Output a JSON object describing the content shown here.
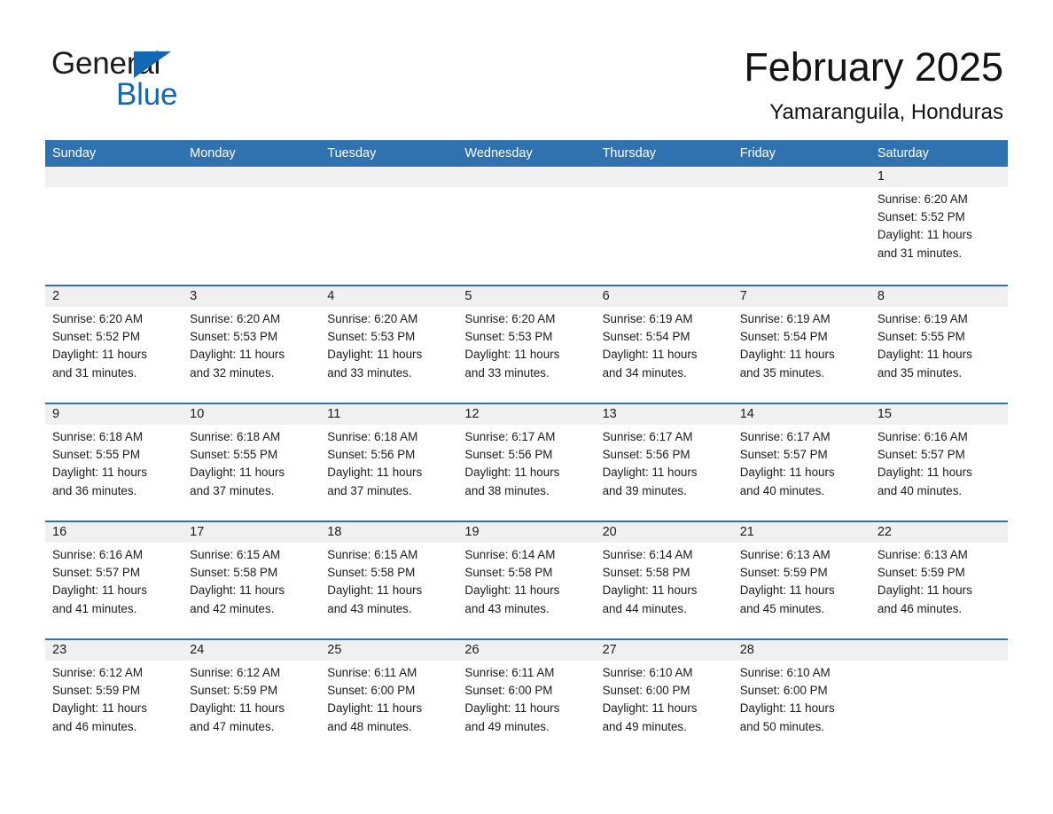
{
  "brand": {
    "name_part1": "General",
    "name_part2": "Blue",
    "triangle_color": "#1368b5",
    "text_color": "#1c1c1c"
  },
  "header": {
    "title": "February 2025",
    "subtitle": "Yamaranguila, Honduras"
  },
  "theme": {
    "header_blue": "#3071b0",
    "daynum_band": "#f0f0f0",
    "cell_background": "#ffffff",
    "text": "#1b1b1b"
  },
  "weekdays": [
    "Sunday",
    "Monday",
    "Tuesday",
    "Wednesday",
    "Thursday",
    "Friday",
    "Saturday"
  ],
  "weeks": [
    [
      {
        "day": "",
        "sunrise": "",
        "sunset": "",
        "daylight1": "",
        "daylight2": ""
      },
      {
        "day": "",
        "sunrise": "",
        "sunset": "",
        "daylight1": "",
        "daylight2": ""
      },
      {
        "day": "",
        "sunrise": "",
        "sunset": "",
        "daylight1": "",
        "daylight2": ""
      },
      {
        "day": "",
        "sunrise": "",
        "sunset": "",
        "daylight1": "",
        "daylight2": ""
      },
      {
        "day": "",
        "sunrise": "",
        "sunset": "",
        "daylight1": "",
        "daylight2": ""
      },
      {
        "day": "",
        "sunrise": "",
        "sunset": "",
        "daylight1": "",
        "daylight2": ""
      },
      {
        "day": "1",
        "sunrise": "Sunrise: 6:20 AM",
        "sunset": "Sunset: 5:52 PM",
        "daylight1": "Daylight: 11 hours",
        "daylight2": "and 31 minutes."
      }
    ],
    [
      {
        "day": "2",
        "sunrise": "Sunrise: 6:20 AM",
        "sunset": "Sunset: 5:52 PM",
        "daylight1": "Daylight: 11 hours",
        "daylight2": "and 31 minutes."
      },
      {
        "day": "3",
        "sunrise": "Sunrise: 6:20 AM",
        "sunset": "Sunset: 5:53 PM",
        "daylight1": "Daylight: 11 hours",
        "daylight2": "and 32 minutes."
      },
      {
        "day": "4",
        "sunrise": "Sunrise: 6:20 AM",
        "sunset": "Sunset: 5:53 PM",
        "daylight1": "Daylight: 11 hours",
        "daylight2": "and 33 minutes."
      },
      {
        "day": "5",
        "sunrise": "Sunrise: 6:20 AM",
        "sunset": "Sunset: 5:53 PM",
        "daylight1": "Daylight: 11 hours",
        "daylight2": "and 33 minutes."
      },
      {
        "day": "6",
        "sunrise": "Sunrise: 6:19 AM",
        "sunset": "Sunset: 5:54 PM",
        "daylight1": "Daylight: 11 hours",
        "daylight2": "and 34 minutes."
      },
      {
        "day": "7",
        "sunrise": "Sunrise: 6:19 AM",
        "sunset": "Sunset: 5:54 PM",
        "daylight1": "Daylight: 11 hours",
        "daylight2": "and 35 minutes."
      },
      {
        "day": "8",
        "sunrise": "Sunrise: 6:19 AM",
        "sunset": "Sunset: 5:55 PM",
        "daylight1": "Daylight: 11 hours",
        "daylight2": "and 35 minutes."
      }
    ],
    [
      {
        "day": "9",
        "sunrise": "Sunrise: 6:18 AM",
        "sunset": "Sunset: 5:55 PM",
        "daylight1": "Daylight: 11 hours",
        "daylight2": "and 36 minutes."
      },
      {
        "day": "10",
        "sunrise": "Sunrise: 6:18 AM",
        "sunset": "Sunset: 5:55 PM",
        "daylight1": "Daylight: 11 hours",
        "daylight2": "and 37 minutes."
      },
      {
        "day": "11",
        "sunrise": "Sunrise: 6:18 AM",
        "sunset": "Sunset: 5:56 PM",
        "daylight1": "Daylight: 11 hours",
        "daylight2": "and 37 minutes."
      },
      {
        "day": "12",
        "sunrise": "Sunrise: 6:17 AM",
        "sunset": "Sunset: 5:56 PM",
        "daylight1": "Daylight: 11 hours",
        "daylight2": "and 38 minutes."
      },
      {
        "day": "13",
        "sunrise": "Sunrise: 6:17 AM",
        "sunset": "Sunset: 5:56 PM",
        "daylight1": "Daylight: 11 hours",
        "daylight2": "and 39 minutes."
      },
      {
        "day": "14",
        "sunrise": "Sunrise: 6:17 AM",
        "sunset": "Sunset: 5:57 PM",
        "daylight1": "Daylight: 11 hours",
        "daylight2": "and 40 minutes."
      },
      {
        "day": "15",
        "sunrise": "Sunrise: 6:16 AM",
        "sunset": "Sunset: 5:57 PM",
        "daylight1": "Daylight: 11 hours",
        "daylight2": "and 40 minutes."
      }
    ],
    [
      {
        "day": "16",
        "sunrise": "Sunrise: 6:16 AM",
        "sunset": "Sunset: 5:57 PM",
        "daylight1": "Daylight: 11 hours",
        "daylight2": "and 41 minutes."
      },
      {
        "day": "17",
        "sunrise": "Sunrise: 6:15 AM",
        "sunset": "Sunset: 5:58 PM",
        "daylight1": "Daylight: 11 hours",
        "daylight2": "and 42 minutes."
      },
      {
        "day": "18",
        "sunrise": "Sunrise: 6:15 AM",
        "sunset": "Sunset: 5:58 PM",
        "daylight1": "Daylight: 11 hours",
        "daylight2": "and 43 minutes."
      },
      {
        "day": "19",
        "sunrise": "Sunrise: 6:14 AM",
        "sunset": "Sunset: 5:58 PM",
        "daylight1": "Daylight: 11 hours",
        "daylight2": "and 43 minutes."
      },
      {
        "day": "20",
        "sunrise": "Sunrise: 6:14 AM",
        "sunset": "Sunset: 5:58 PM",
        "daylight1": "Daylight: 11 hours",
        "daylight2": "and 44 minutes."
      },
      {
        "day": "21",
        "sunrise": "Sunrise: 6:13 AM",
        "sunset": "Sunset: 5:59 PM",
        "daylight1": "Daylight: 11 hours",
        "daylight2": "and 45 minutes."
      },
      {
        "day": "22",
        "sunrise": "Sunrise: 6:13 AM",
        "sunset": "Sunset: 5:59 PM",
        "daylight1": "Daylight: 11 hours",
        "daylight2": "and 46 minutes."
      }
    ],
    [
      {
        "day": "23",
        "sunrise": "Sunrise: 6:12 AM",
        "sunset": "Sunset: 5:59 PM",
        "daylight1": "Daylight: 11 hours",
        "daylight2": "and 46 minutes."
      },
      {
        "day": "24",
        "sunrise": "Sunrise: 6:12 AM",
        "sunset": "Sunset: 5:59 PM",
        "daylight1": "Daylight: 11 hours",
        "daylight2": "and 47 minutes."
      },
      {
        "day": "25",
        "sunrise": "Sunrise: 6:11 AM",
        "sunset": "Sunset: 6:00 PM",
        "daylight1": "Daylight: 11 hours",
        "daylight2": "and 48 minutes."
      },
      {
        "day": "26",
        "sunrise": "Sunrise: 6:11 AM",
        "sunset": "Sunset: 6:00 PM",
        "daylight1": "Daylight: 11 hours",
        "daylight2": "and 49 minutes."
      },
      {
        "day": "27",
        "sunrise": "Sunrise: 6:10 AM",
        "sunset": "Sunset: 6:00 PM",
        "daylight1": "Daylight: 11 hours",
        "daylight2": "and 49 minutes."
      },
      {
        "day": "28",
        "sunrise": "Sunrise: 6:10 AM",
        "sunset": "Sunset: 6:00 PM",
        "daylight1": "Daylight: 11 hours",
        "daylight2": "and 50 minutes."
      },
      {
        "day": "",
        "sunrise": "",
        "sunset": "",
        "daylight1": "",
        "daylight2": ""
      }
    ]
  ]
}
